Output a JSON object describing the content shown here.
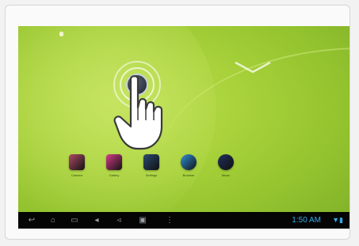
{
  "status_bar": {
    "left_icon": "notification-icon",
    "right_text": "--:--"
  },
  "lock_screen": {
    "unlock_icon": "lock-circle-icon",
    "unlock_arrow": "chevron-down-icon",
    "gesture_icon": "pointing-hand-icon"
  },
  "dock": {
    "apps": [
      {
        "icon": "camera-icon",
        "label": "Camera",
        "color": "#b04a66"
      },
      {
        "icon": "gallery-icon",
        "label": "Gallery",
        "color": "#d63b8a"
      },
      {
        "icon": "settings-icon",
        "label": "Settings",
        "color": "#2b4a6f"
      },
      {
        "icon": "browser-icon",
        "label": "Browser",
        "color": "#2f8fd8"
      },
      {
        "icon": "music-icon",
        "label": "Music",
        "color": "#20305a"
      }
    ]
  },
  "nav_bar": {
    "buttons": [
      "back-icon",
      "home-icon",
      "recent-apps-icon",
      "volume-down-icon",
      "volume-up-icon",
      "screenshot-icon",
      "menu-icon"
    ],
    "clock": "1:50 AM",
    "status_icons": "▼▮"
  },
  "colors": {
    "wallpaper": "#a9d23b",
    "clock_text": "#35a8e6",
    "nav_background": "#050505"
  }
}
